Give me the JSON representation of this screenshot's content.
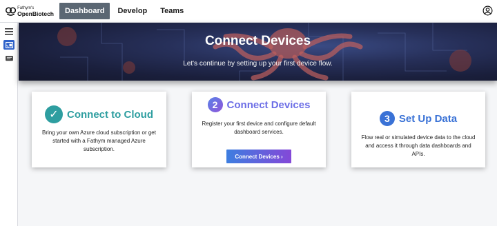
{
  "brand": {
    "small": "Fathym's",
    "name": "OpenBiotech"
  },
  "nav": {
    "items": [
      {
        "label": "Dashboard",
        "active": true
      },
      {
        "label": "Develop",
        "active": false
      },
      {
        "label": "Teams",
        "active": false
      }
    ]
  },
  "account": {
    "icon": "account-circle-icon"
  },
  "sidebar": {
    "items": [
      {
        "icon": "menu-icon"
      },
      {
        "icon": "cast-connected-icon",
        "active": true
      },
      {
        "icon": "message-icon"
      }
    ]
  },
  "hero": {
    "title": "Connect Devices",
    "subtitle": "Let's continue by setting up your first device flow."
  },
  "cards": [
    {
      "step": "✓",
      "title": "Connect to Cloud",
      "text": "Bring your own Azure cloud subscription or get started with a Fathym managed Azure subscription.",
      "color": "#2e9ea0"
    },
    {
      "step": "2",
      "title": "Connect Devices",
      "text": "Register your first device and configure default dashboard services.",
      "button": "Connect Devices ›",
      "color": "#6c6ee6"
    },
    {
      "step": "3",
      "title": "Set Up Data",
      "text": "Flow real or simulated device data to the cloud and access it through data dashboards and APIs.",
      "color": "#3a72d6"
    }
  ]
}
